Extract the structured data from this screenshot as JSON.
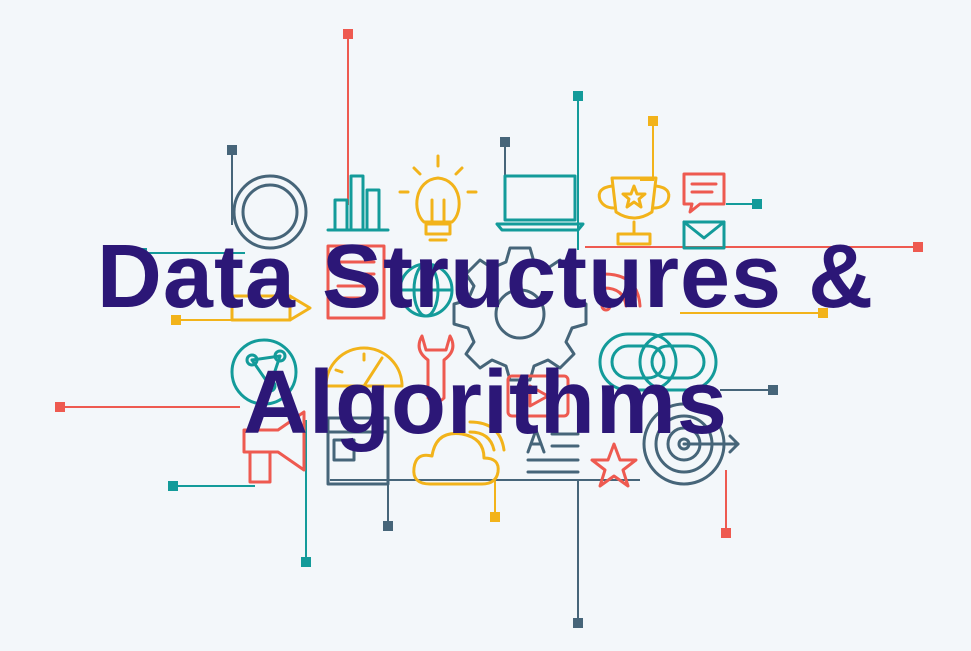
{
  "title": {
    "line1": "Data Structures &",
    "line2": "Algorithms"
  },
  "colors": {
    "background": "#f3f7fa",
    "title": "#2c1777",
    "red": "#ee5a50",
    "teal": "#139b9a",
    "yellow": "#f2b31a",
    "slate": "#466579"
  },
  "icons": [
    "ring-icon",
    "bar-chart-icon",
    "lightbulb-icon",
    "laptop-icon",
    "trophy-icon",
    "chat-bubble-icon",
    "envelope-icon",
    "pencil-icon",
    "document-icon",
    "globe-icon",
    "gear-icon",
    "rss-icon",
    "link-icon",
    "network-icon",
    "gauge-icon",
    "wrench-icon",
    "megaphone-icon",
    "browser-window-icon",
    "cloud-icon",
    "text-lines-icon",
    "star-icon",
    "target-icon",
    "play-button-icon"
  ]
}
